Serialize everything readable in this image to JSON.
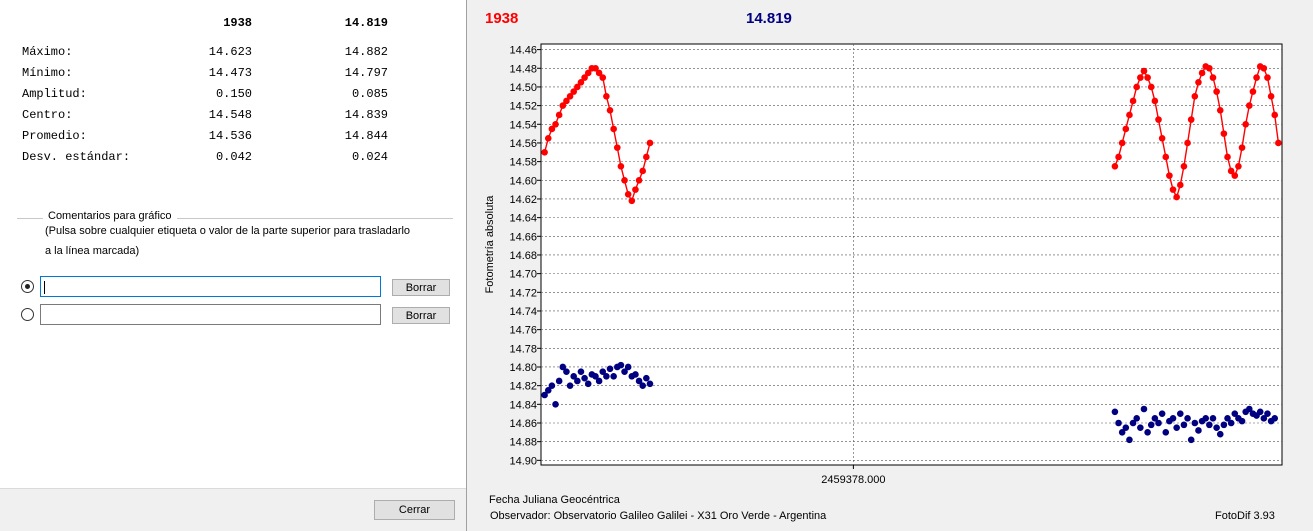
{
  "stats": {
    "headers": [
      "1938",
      "14.819"
    ],
    "rows": [
      {
        "label": "Máximo:",
        "v1": "14.623",
        "v2": "14.882"
      },
      {
        "label": "Mínimo:",
        "v1": "14.473",
        "v2": "14.797"
      },
      {
        "label": "Amplitud:",
        "v1": "0.150",
        "v2": "0.085"
      },
      {
        "label": "Centro:",
        "v1": "14.548",
        "v2": "14.839"
      },
      {
        "label": "Promedio:",
        "v1": "14.536",
        "v2": "14.844"
      },
      {
        "label": "Desv. estándar:",
        "v1": "0.042",
        "v2": "0.024"
      }
    ]
  },
  "comments": {
    "title": "Comentarios para gráfico",
    "help_line1": "(Pulsa sobre cualquier etiqueta o valor de la parte superior para trasladarlo",
    "help_line2": "a la línea marcada)",
    "field1_value": "",
    "field2_value": "",
    "clear_label": "Borrar"
  },
  "close_label": "Cerrar",
  "chart_window": {
    "footer_left_1": "Fecha Juliana Geocéntrica",
    "footer_left_2": "Observador: Observatorio Galileo Galilei - X31 Oro Verde - Argentina",
    "footer_right": "FotoDif 3.93"
  },
  "chart_data": {
    "type": "scatter",
    "title": "",
    "xlabel": "Fecha Juliana Geocéntrica",
    "ylabel": "Fotometría absoluta",
    "x_tick_labels": [
      "2459378.000"
    ],
    "y_inverted": true,
    "ylim": [
      14.46,
      14.9
    ],
    "y_ticks": [
      "14.46",
      "14.48",
      "14.50",
      "14.52",
      "14.54",
      "14.56",
      "14.58",
      "14.60",
      "14.62",
      "14.64",
      "14.66",
      "14.68",
      "14.70",
      "14.72",
      "14.74",
      "14.76",
      "14.78",
      "14.80",
      "14.82",
      "14.84",
      "14.86",
      "14.88",
      "14.90"
    ],
    "xlim": [
      0,
      100
    ],
    "x_tick_positions": [
      43
    ],
    "grid": true,
    "colors": {
      "series1": "#ff0000",
      "series2": "#000080"
    },
    "series": [
      {
        "name": "1938",
        "color": "#ff0000",
        "line": true,
        "segments": [
          [
            [
              0.5,
              14.57
            ],
            [
              1.0,
              14.555
            ],
            [
              1.5,
              14.545
            ],
            [
              2.0,
              14.54
            ],
            [
              2.5,
              14.53
            ],
            [
              3.0,
              14.52
            ],
            [
              3.5,
              14.515
            ],
            [
              4.0,
              14.51
            ],
            [
              4.5,
              14.505
            ],
            [
              5.0,
              14.5
            ],
            [
              5.5,
              14.495
            ],
            [
              6.0,
              14.49
            ],
            [
              6.5,
              14.485
            ],
            [
              7.0,
              14.48
            ],
            [
              7.5,
              14.48
            ],
            [
              8.0,
              14.485
            ],
            [
              8.5,
              14.49
            ],
            [
              9.0,
              14.51
            ],
            [
              9.5,
              14.525
            ],
            [
              10.0,
              14.545
            ],
            [
              10.5,
              14.565
            ],
            [
              11.0,
              14.585
            ],
            [
              11.5,
              14.6
            ],
            [
              12.0,
              14.615
            ],
            [
              12.5,
              14.622
            ],
            [
              13.0,
              14.61
            ],
            [
              13.5,
              14.6
            ],
            [
              14.0,
              14.59
            ],
            [
              14.5,
              14.575
            ],
            [
              15.0,
              14.56
            ]
          ],
          [
            [
              79.0,
              14.585
            ],
            [
              79.5,
              14.575
            ],
            [
              80.0,
              14.56
            ],
            [
              80.5,
              14.545
            ],
            [
              81.0,
              14.53
            ],
            [
              81.5,
              14.515
            ],
            [
              82.0,
              14.5
            ],
            [
              82.5,
              14.49
            ],
            [
              83.0,
              14.483
            ],
            [
              83.5,
              14.49
            ],
            [
              84.0,
              14.5
            ],
            [
              84.5,
              14.515
            ],
            [
              85.0,
              14.535
            ],
            [
              85.5,
              14.555
            ],
            [
              86.0,
              14.575
            ],
            [
              86.5,
              14.595
            ],
            [
              87.0,
              14.61
            ],
            [
              87.5,
              14.618
            ],
            [
              88.0,
              14.605
            ],
            [
              88.5,
              14.585
            ],
            [
              89.0,
              14.56
            ],
            [
              89.5,
              14.535
            ],
            [
              90.0,
              14.51
            ],
            [
              90.5,
              14.495
            ],
            [
              91.0,
              14.485
            ],
            [
              91.5,
              14.478
            ],
            [
              92.0,
              14.48
            ],
            [
              92.5,
              14.49
            ],
            [
              93.0,
              14.505
            ],
            [
              93.5,
              14.525
            ],
            [
              94.0,
              14.55
            ],
            [
              94.5,
              14.575
            ],
            [
              95.0,
              14.59
            ],
            [
              95.5,
              14.595
            ],
            [
              96.0,
              14.585
            ],
            [
              96.5,
              14.565
            ],
            [
              97.0,
              14.54
            ],
            [
              97.5,
              14.52
            ],
            [
              98.0,
              14.505
            ],
            [
              98.5,
              14.49
            ],
            [
              99.0,
              14.478
            ],
            [
              99.5,
              14.48
            ],
            [
              100.0,
              14.49
            ],
            [
              100.5,
              14.51
            ],
            [
              101.0,
              14.53
            ],
            [
              101.5,
              14.56
            ]
          ]
        ]
      },
      {
        "name": "14.819",
        "color": "#000080",
        "line": false,
        "segments": [
          [
            [
              0.5,
              14.83
            ],
            [
              1.0,
              14.825
            ],
            [
              1.5,
              14.82
            ],
            [
              2.0,
              14.84
            ],
            [
              2.5,
              14.815
            ],
            [
              3.0,
              14.8
            ],
            [
              3.5,
              14.805
            ],
            [
              4.0,
              14.82
            ],
            [
              4.5,
              14.81
            ],
            [
              5.0,
              14.815
            ],
            [
              5.5,
              14.805
            ],
            [
              6.0,
              14.812
            ],
            [
              6.5,
              14.818
            ],
            [
              7.0,
              14.808
            ],
            [
              7.5,
              14.81
            ],
            [
              8.0,
              14.815
            ],
            [
              8.5,
              14.805
            ],
            [
              9.0,
              14.81
            ],
            [
              9.5,
              14.802
            ],
            [
              10.0,
              14.81
            ],
            [
              10.5,
              14.8
            ],
            [
              11.0,
              14.798
            ],
            [
              11.5,
              14.805
            ],
            [
              12.0,
              14.8
            ],
            [
              12.5,
              14.81
            ],
            [
              13.0,
              14.808
            ],
            [
              13.5,
              14.815
            ],
            [
              14.0,
              14.82
            ],
            [
              14.5,
              14.812
            ],
            [
              15.0,
              14.818
            ]
          ],
          [
            [
              79.0,
              14.848
            ],
            [
              79.5,
              14.86
            ],
            [
              80.0,
              14.87
            ],
            [
              80.5,
              14.865
            ],
            [
              81.0,
              14.878
            ],
            [
              81.5,
              14.86
            ],
            [
              82.0,
              14.855
            ],
            [
              82.5,
              14.865
            ],
            [
              83.0,
              14.845
            ],
            [
              83.5,
              14.87
            ],
            [
              84.0,
              14.862
            ],
            [
              84.5,
              14.855
            ],
            [
              85.0,
              14.86
            ],
            [
              85.5,
              14.85
            ],
            [
              86.0,
              14.87
            ],
            [
              86.5,
              14.858
            ],
            [
              87.0,
              14.855
            ],
            [
              87.5,
              14.865
            ],
            [
              88.0,
              14.85
            ],
            [
              88.5,
              14.862
            ],
            [
              89.0,
              14.855
            ],
            [
              89.5,
              14.878
            ],
            [
              90.0,
              14.86
            ],
            [
              90.5,
              14.868
            ],
            [
              91.0,
              14.858
            ],
            [
              91.5,
              14.855
            ],
            [
              92.0,
              14.862
            ],
            [
              92.5,
              14.855
            ],
            [
              93.0,
              14.865
            ],
            [
              93.5,
              14.872
            ],
            [
              94.0,
              14.862
            ],
            [
              94.5,
              14.855
            ],
            [
              95.0,
              14.86
            ],
            [
              95.5,
              14.85
            ],
            [
              96.0,
              14.855
            ],
            [
              96.5,
              14.858
            ],
            [
              97.0,
              14.848
            ],
            [
              97.5,
              14.845
            ],
            [
              98.0,
              14.85
            ],
            [
              98.5,
              14.852
            ],
            [
              99.0,
              14.848
            ],
            [
              99.5,
              14.855
            ],
            [
              100.0,
              14.85
            ],
            [
              100.5,
              14.858
            ],
            [
              101.0,
              14.855
            ]
          ]
        ]
      }
    ]
  }
}
